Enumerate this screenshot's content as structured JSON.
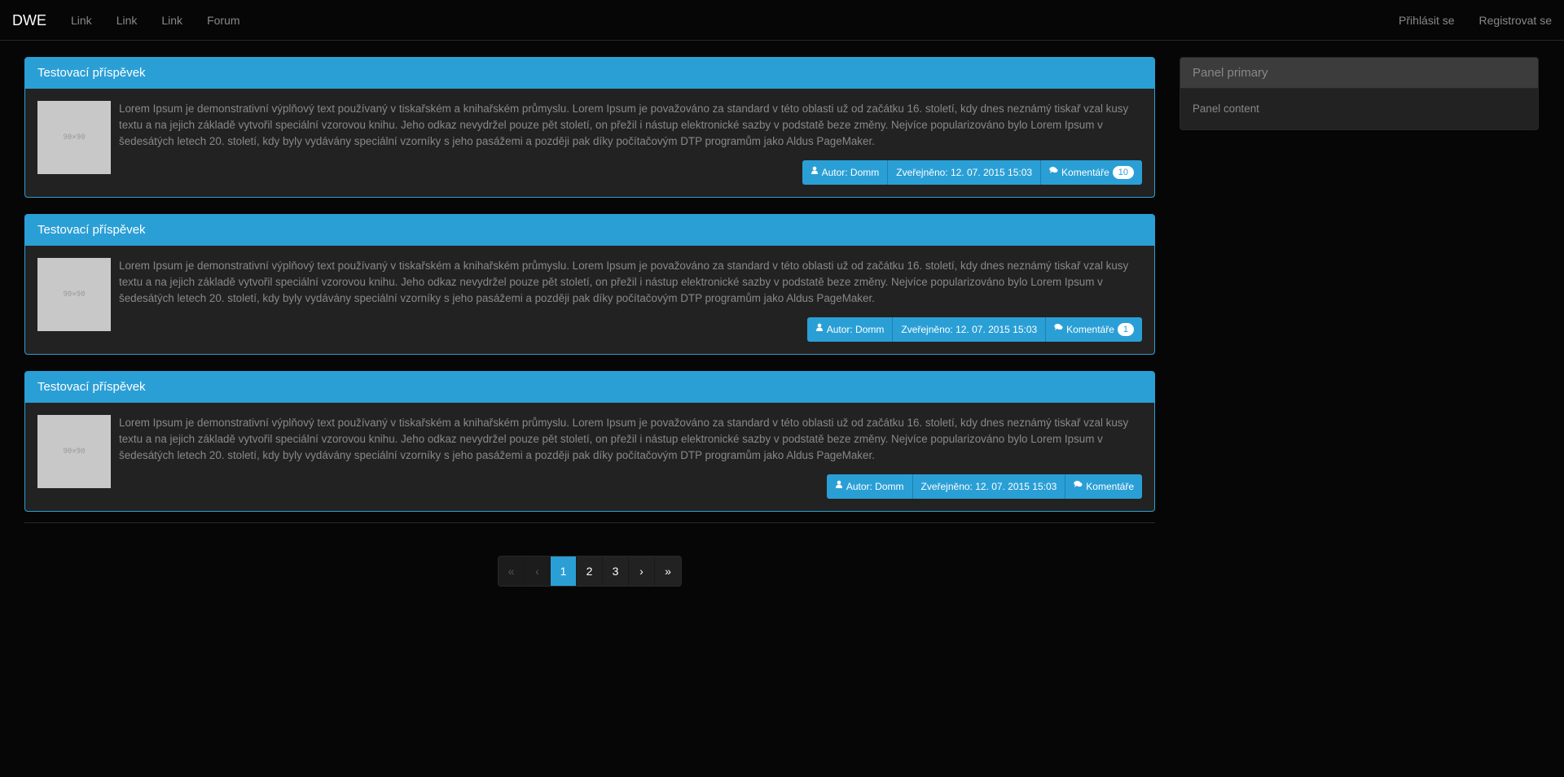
{
  "navbar": {
    "brand": "DWE",
    "links": [
      "Link",
      "Link",
      "Link",
      "Forum"
    ],
    "login": "Přihlásit se",
    "register": "Registrovat se"
  },
  "posts": [
    {
      "title": "Testovací příspěvek",
      "thumb": "90×90",
      "text": "Lorem Ipsum je demonstrativní výplňový text používaný v tiskařském a knihařském průmyslu. Lorem Ipsum je považováno za standard v této oblasti už od začátku 16. století, kdy dnes neznámý tiskař vzal kusy textu a na jejich základě vytvořil speciální vzorovou knihu. Jeho odkaz nevydržel pouze pět století, on přežil i nástup elektronické sazby v podstatě beze změny. Nejvíce popularizováno bylo Lorem Ipsum v šedesátých letech 20. století, kdy byly vydávány speciální vzorníky s jeho pasážemi a později pak díky počítačovým DTP programům jako Aldus PageMaker.",
      "author": "Autor: Domm",
      "published": "Zveřejněno: 12. 07. 2015 15:03",
      "comments_label": "Komentáře",
      "comments_count": "10"
    },
    {
      "title": "Testovací příspěvek",
      "thumb": "90×90",
      "text": "Lorem Ipsum je demonstrativní výplňový text používaný v tiskařském a knihařském průmyslu. Lorem Ipsum je považováno za standard v této oblasti už od začátku 16. století, kdy dnes neznámý tiskař vzal kusy textu a na jejich základě vytvořil speciální vzorovou knihu. Jeho odkaz nevydržel pouze pět století, on přežil i nástup elektronické sazby v podstatě beze změny. Nejvíce popularizováno bylo Lorem Ipsum v šedesátých letech 20. století, kdy byly vydávány speciální vzorníky s jeho pasážemi a později pak díky počítačovým DTP programům jako Aldus PageMaker.",
      "author": "Autor: Domm",
      "published": "Zveřejněno: 12. 07. 2015 15:03",
      "comments_label": "Komentáře",
      "comments_count": "1"
    },
    {
      "title": "Testovací příspěvek",
      "thumb": "90×90",
      "text": "Lorem Ipsum je demonstrativní výplňový text používaný v tiskařském a knihařském průmyslu. Lorem Ipsum je považováno za standard v této oblasti už od začátku 16. století, kdy dnes neznámý tiskař vzal kusy textu a na jejich základě vytvořil speciální vzorovou knihu. Jeho odkaz nevydržel pouze pět století, on přežil i nástup elektronické sazby v podstatě beze změny. Nejvíce popularizováno bylo Lorem Ipsum v šedesátých letech 20. století, kdy byly vydávány speciální vzorníky s jeho pasážemi a později pak díky počítačovým DTP programům jako Aldus PageMaker.",
      "author": "Autor: Domm",
      "published": "Zveřejněno: 12. 07. 2015 15:03",
      "comments_label": "Komentáře",
      "comments_count": null
    }
  ],
  "pagination": {
    "first": "«",
    "prev": "‹",
    "pages": [
      "1",
      "2",
      "3"
    ],
    "active_page": "1",
    "next": "›",
    "last": "»"
  },
  "panel": {
    "title": "Panel primary",
    "content": "Panel content"
  },
  "colors": {
    "accent": "#2a9fd6",
    "background": "#060606",
    "surface": "#222222"
  },
  "icons": {
    "author": "user-icon",
    "comments": "comments-icon"
  }
}
